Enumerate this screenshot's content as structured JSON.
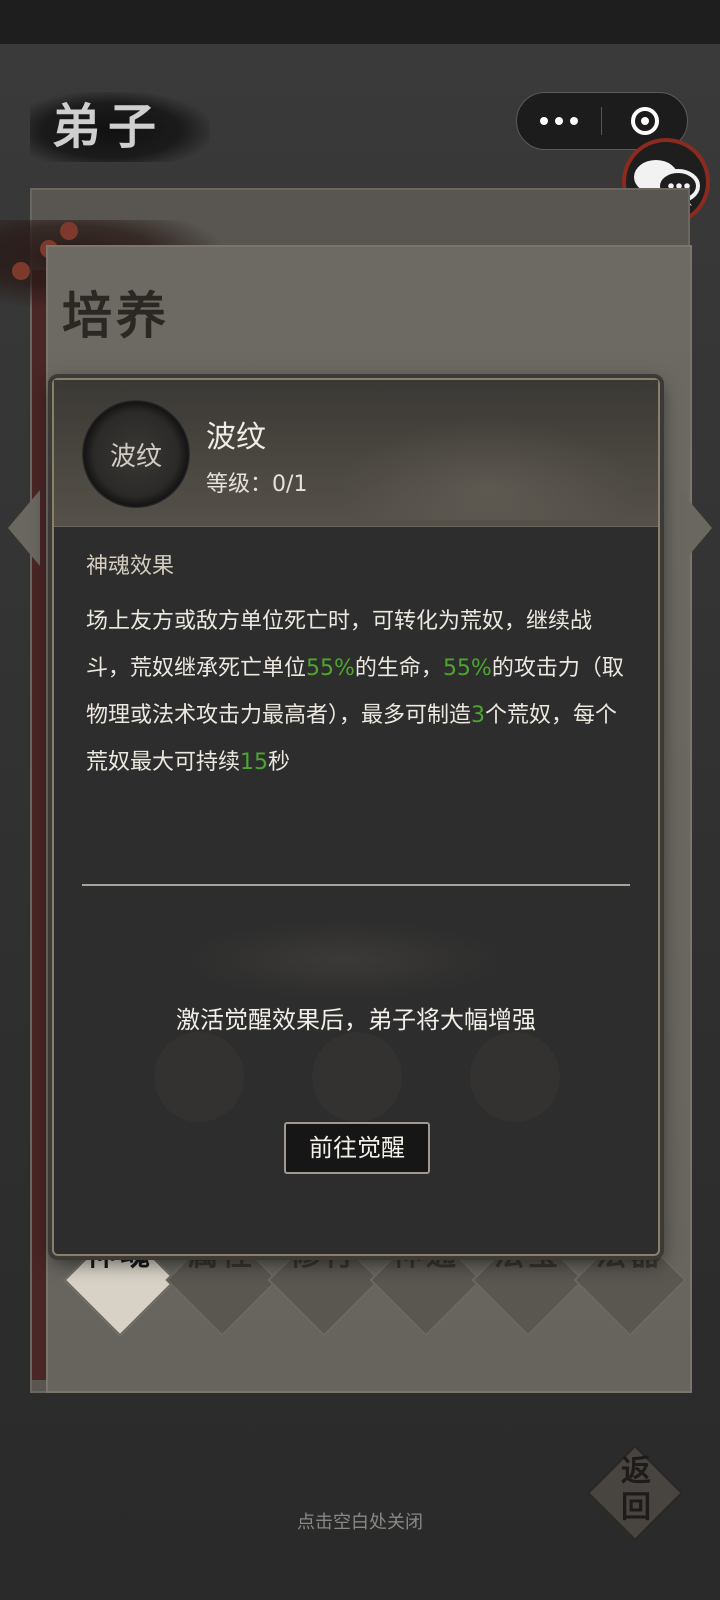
{
  "page": {
    "title": "弟子"
  },
  "capsule": {
    "more_icon": "more-dots-icon",
    "close_icon": "ring-target-icon"
  },
  "chat": {
    "icon": "chat-bubbles-icon"
  },
  "panel": {
    "section_title": "培养",
    "tabs": [
      "神魂",
      "属性",
      "修行",
      "神通",
      "法宝",
      "法器"
    ],
    "active_tab": 0
  },
  "card": {
    "badge_text": "波纹",
    "skill_name": "波纹",
    "level_label": "等级",
    "level_value": "0/1",
    "effect_title": "神魂效果",
    "effect": {
      "t1": "场上友方或敌方单位死亡时，可转化为荒奴，继续战斗，荒奴继承死亡单位",
      "v1": "55%",
      "t2": "的生命，",
      "v2": "55%",
      "t3": "的攻击力（取物理或法术攻击力最高者），最多可制造",
      "v3": "3",
      "t4": "个荒奴，每个荒奴最大可持续",
      "v4": "15",
      "t5": "秒"
    },
    "awaken_hint": "激活觉醒效果后，弟子将大幅增强",
    "go_button": "前往觉醒"
  },
  "footer": {
    "back_label": "返回",
    "close_hint": "点击空白处关闭"
  },
  "colors": {
    "highlight": "#4ea52e",
    "accent_red": "#8b2a1f"
  }
}
